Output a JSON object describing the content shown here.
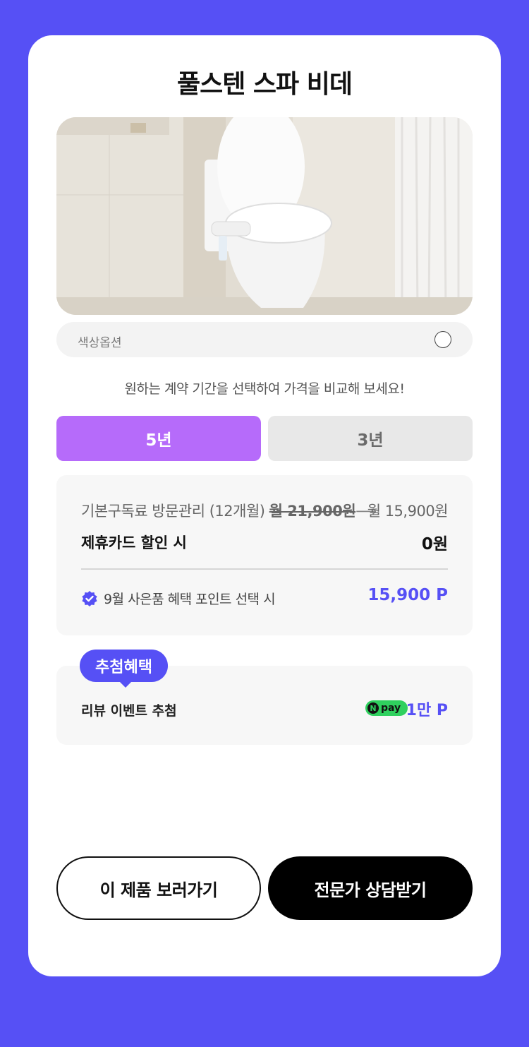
{
  "product": {
    "title": "풀스텐 스파 비데",
    "image_alt": "bidet toilet photo"
  },
  "color_option": {
    "label": "색상옵션"
  },
  "guide_text": "원하는 계약 기간을 선택하여 가격을 비교해 보세요!",
  "tabs": [
    {
      "label": "5년",
      "selected": true
    },
    {
      "label": "3년",
      "selected": false
    }
  ],
  "pricing": {
    "base_label": "기본구독료 방문관리 (12개월)",
    "old_price": "월 21,900원",
    "arrow": "⟶",
    "new_price": "월 15,900원",
    "card_label": "제휴카드 할인 시",
    "card_value": "0원",
    "gift_label": "9월 사은품 혜택 포인트 선택 시",
    "gift_value": "15,900 P"
  },
  "bonus": {
    "badge": "추첨혜택",
    "label": "리뷰 이벤트 추첨",
    "pay_brand_n": "N",
    "pay_brand": "pay",
    "value": "1만 P"
  },
  "buttons": {
    "view_product": "이 제품 보러가기",
    "consult": "전문가 상담받기"
  },
  "colors": {
    "background": "#5650f5",
    "tab_selected": "#b66bfa",
    "accent": "#5650f5",
    "npay": "#2fd05e"
  }
}
